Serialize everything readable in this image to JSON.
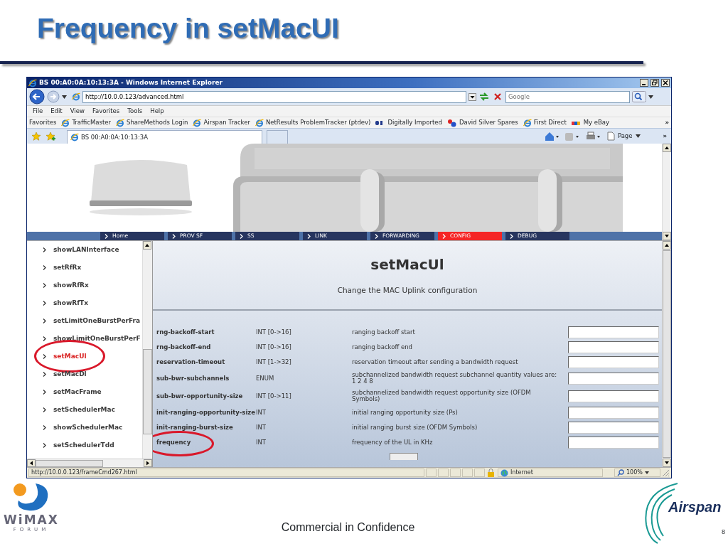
{
  "slide": {
    "title": "Frequency in setMacUI",
    "footer": "Commercial in Confidence",
    "page_number": "8",
    "left_logo": {
      "text": "WiMAX",
      "subtext": "FORUM"
    },
    "right_logo": {
      "text": "Airspan"
    }
  },
  "browser": {
    "title": "BS 00:A0:0A:10:13:3A - Windows Internet Explorer",
    "address": "http://10.0.0.123/advanced.html",
    "search_placeholder": "Google",
    "menu": [
      "File",
      "Edit",
      "View",
      "Favorites",
      "Tools",
      "Help"
    ],
    "favorites_label": "Favorites",
    "favorites": [
      {
        "label": "TrafficMaster",
        "kind": "ie"
      },
      {
        "label": "ShareMethods Login",
        "kind": "ie"
      },
      {
        "label": "Airspan Tracker",
        "kind": "ie"
      },
      {
        "label": "NetResults ProblemTracker (ptdev)",
        "kind": "ie"
      },
      {
        "label": "Digitally Imported",
        "kind": "logo"
      },
      {
        "label": "David Silver Spares",
        "kind": "logo2"
      },
      {
        "label": "First Direct",
        "kind": "ie"
      },
      {
        "label": "My eBay",
        "kind": "logo3"
      }
    ],
    "favorites_more": "»",
    "tab": "BS 00:A0:0A:10:13:3A",
    "page_menu": "Page",
    "toolbar_more": "»",
    "status": {
      "url": "http://10.0.0.123/frameCmd267.html",
      "zone": "Internet",
      "zoom": "100%"
    }
  },
  "page": {
    "nav": [
      {
        "label": "Home",
        "selected": false
      },
      {
        "label": "PROV SF",
        "selected": false
      },
      {
        "label": "SS",
        "selected": false
      },
      {
        "label": "LINK",
        "selected": false
      },
      {
        "label": "FORWARDING",
        "selected": false
      },
      {
        "label": "CONFIG",
        "selected": true
      },
      {
        "label": "DEBUG",
        "selected": false
      }
    ],
    "sidebar": [
      {
        "label": "showLANInterface",
        "selected": false,
        "circled": false
      },
      {
        "label": "setRfRx",
        "selected": false,
        "circled": false
      },
      {
        "label": "showRfRx",
        "selected": false,
        "circled": false
      },
      {
        "label": "showRfTx",
        "selected": false,
        "circled": false
      },
      {
        "label": "setLimitOneBurstPerFra",
        "selected": false,
        "circled": false
      },
      {
        "label": "showLimitOneBurstPerF",
        "selected": false,
        "circled": false
      },
      {
        "label": "setMacUl",
        "selected": true,
        "circled": true
      },
      {
        "label": "setMacDl",
        "selected": false,
        "circled": false
      },
      {
        "label": "setMacFrame",
        "selected": false,
        "circled": false
      },
      {
        "label": "setSchedulerMac",
        "selected": false,
        "circled": false
      },
      {
        "label": "showSchedulerMac",
        "selected": false,
        "circled": false
      },
      {
        "label": "setSchedulerTdd",
        "selected": false,
        "circled": false
      }
    ],
    "heading": "setMacUl",
    "subheading": "Change the MAC Uplink configuration",
    "params": [
      {
        "name": "rng-backoff-start",
        "type": "INT [0->16]",
        "description": "ranging backoff start",
        "circled": false
      },
      {
        "name": "rng-backoff-end",
        "type": "INT [0->16]",
        "description": "ranging backoff end",
        "circled": false
      },
      {
        "name": "reservation-timeout",
        "type": "INT [1->32]",
        "description": "reservation timeout after sending a bandwidth request",
        "circled": false
      },
      {
        "name": "sub-bwr-subchannels",
        "type": "ENUM",
        "description": "subchannelized bandwidth request subchannel quantity values are: 1 2 4 8",
        "circled": false
      },
      {
        "name": "sub-bwr-opportunity-size",
        "type": "INT [0->11]",
        "description": "subchannelized bandwidth request opportunity size (OFDM Symbols)",
        "circled": false
      },
      {
        "name": "init-ranging-opportunity-size",
        "type": "INT",
        "description": "initial ranging opportunity size (Ps)",
        "circled": false
      },
      {
        "name": "init-ranging-burst-size",
        "type": "INT",
        "description": "initial ranging burst size (OFDM Symbols)",
        "circled": false
      },
      {
        "name": "frequency",
        "type": "INT",
        "description": "frequency of the UL in KHz",
        "circled": true
      }
    ]
  }
}
